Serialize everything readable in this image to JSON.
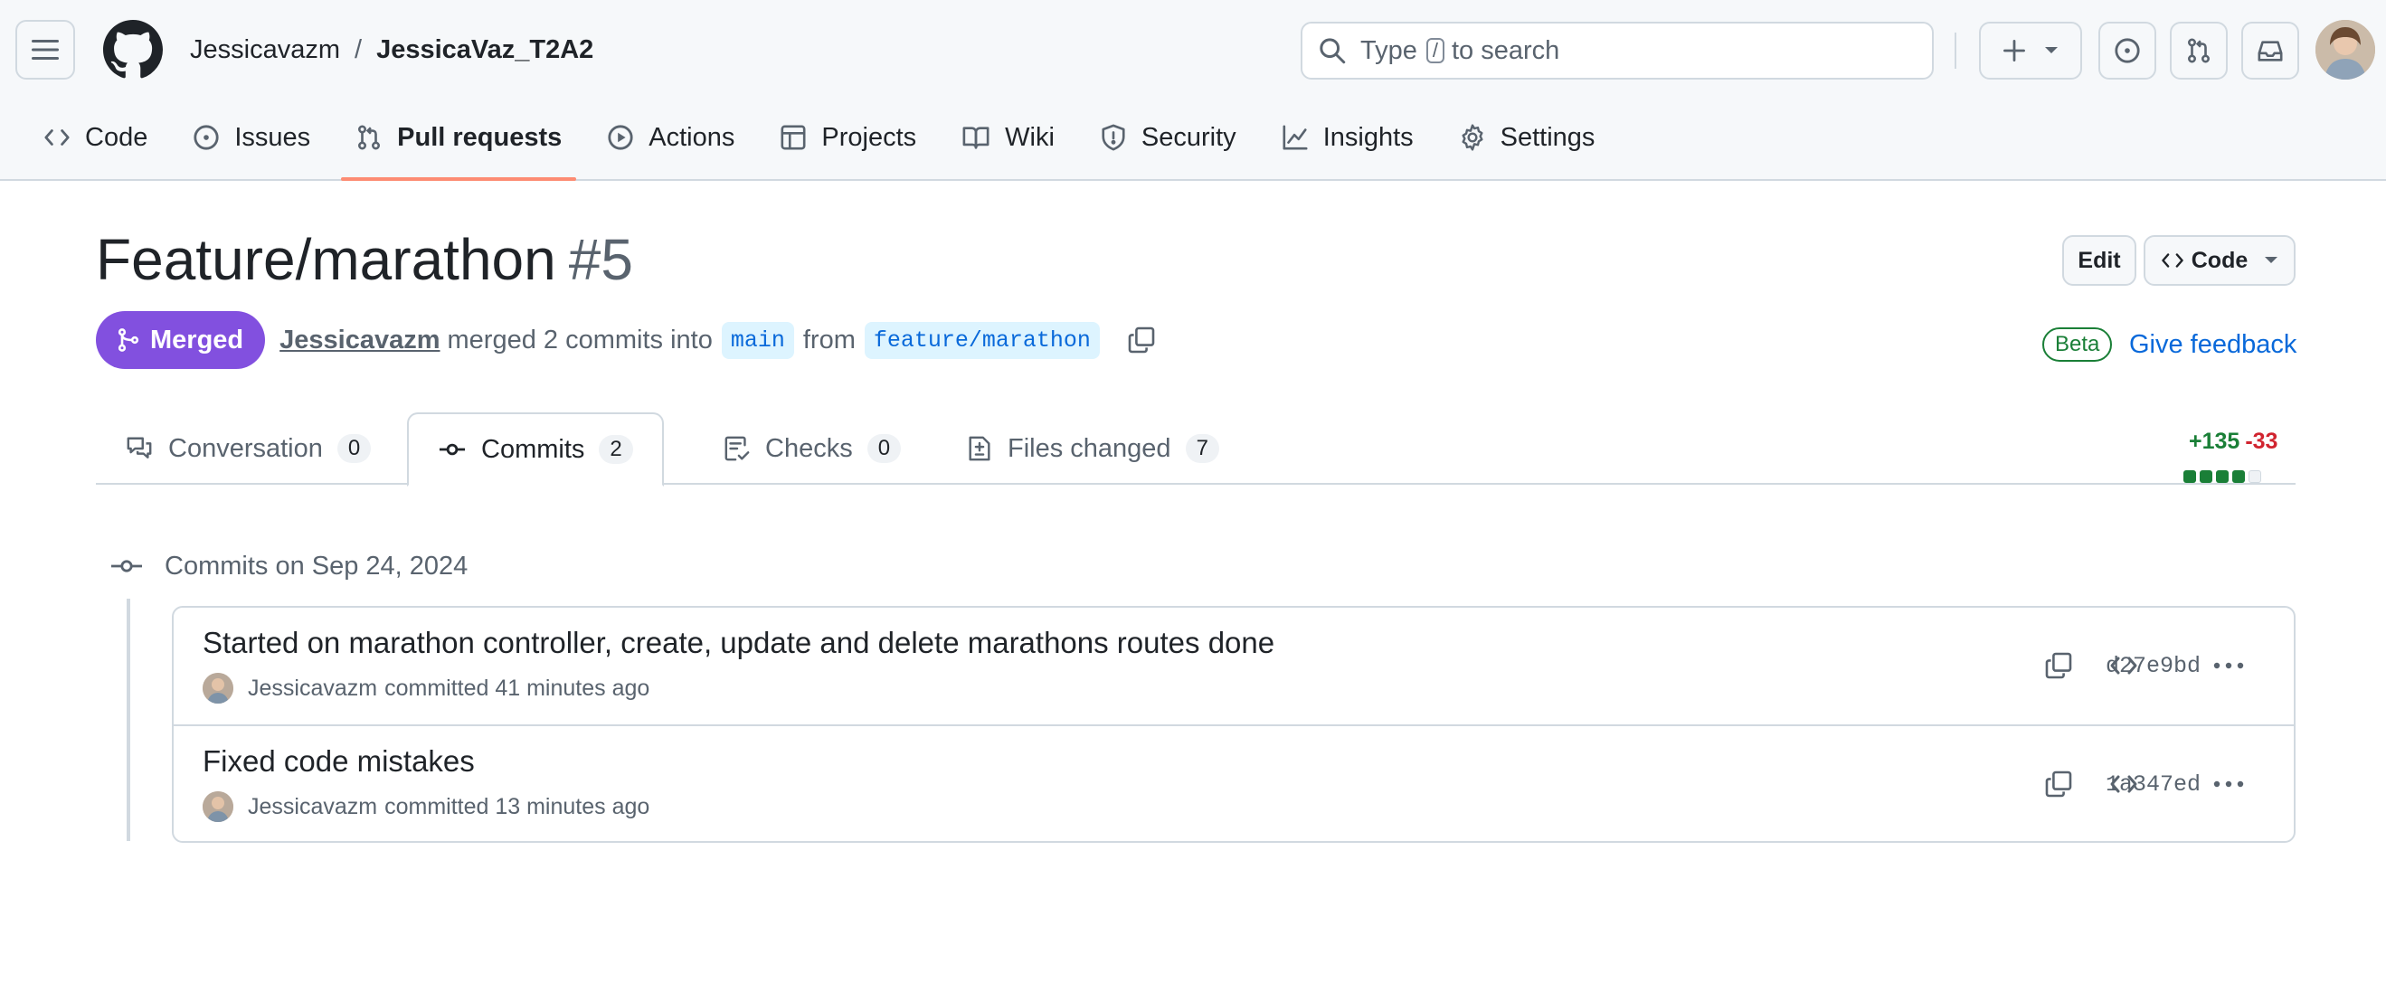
{
  "header": {
    "owner": "Jessicavazm",
    "separator": "/",
    "repo": "JessicaVaz_T2A2",
    "search_prefix": "Type",
    "search_key": "/",
    "search_suffix": "to search"
  },
  "repo_nav": [
    {
      "label": "Code",
      "icon": "code-icon"
    },
    {
      "label": "Issues",
      "icon": "issue-opened-icon"
    },
    {
      "label": "Pull requests",
      "icon": "git-pull-request-icon",
      "active": true
    },
    {
      "label": "Actions",
      "icon": "play-icon"
    },
    {
      "label": "Projects",
      "icon": "table-icon"
    },
    {
      "label": "Wiki",
      "icon": "book-icon"
    },
    {
      "label": "Security",
      "icon": "shield-icon"
    },
    {
      "label": "Insights",
      "icon": "graph-icon"
    },
    {
      "label": "Settings",
      "icon": "gear-icon"
    }
  ],
  "pr": {
    "title": "Feature/marathon",
    "number": "#5",
    "edit_label": "Edit",
    "code_label": "Code",
    "state": "Merged",
    "author": "Jessicavazm",
    "merged_text": "merged 2 commits into",
    "base_branch": "main",
    "from_text": "from",
    "head_branch": "feature/marathon",
    "beta_label": "Beta",
    "feedback_label": "Give feedback"
  },
  "tabs": [
    {
      "label": "Conversation",
      "count": "0"
    },
    {
      "label": "Commits",
      "count": "2",
      "active": true
    },
    {
      "label": "Checks",
      "count": "0"
    },
    {
      "label": "Files changed",
      "count": "7"
    }
  ],
  "diffstat": {
    "additions": "+135",
    "deletions": "-33",
    "green_blocks": 4,
    "total_blocks": 5
  },
  "commits": {
    "date_header": "Commits on Sep 24, 2024",
    "items": [
      {
        "message": "Started on marathon controller, create, update and delete marathons routes done",
        "author": "Jessicavazm",
        "time": "committed 41 minutes ago",
        "sha": "d27e9bd"
      },
      {
        "message": "Fixed code mistakes",
        "author": "Jessicavazm",
        "time": "committed 13 minutes ago",
        "sha": "1a347ed"
      }
    ]
  },
  "colors": {
    "merged": "#8250df",
    "link": "#0969da",
    "addition": "#1a7f37",
    "deletion": "#d1242f",
    "active_tab_underline": "#fd8c73"
  }
}
